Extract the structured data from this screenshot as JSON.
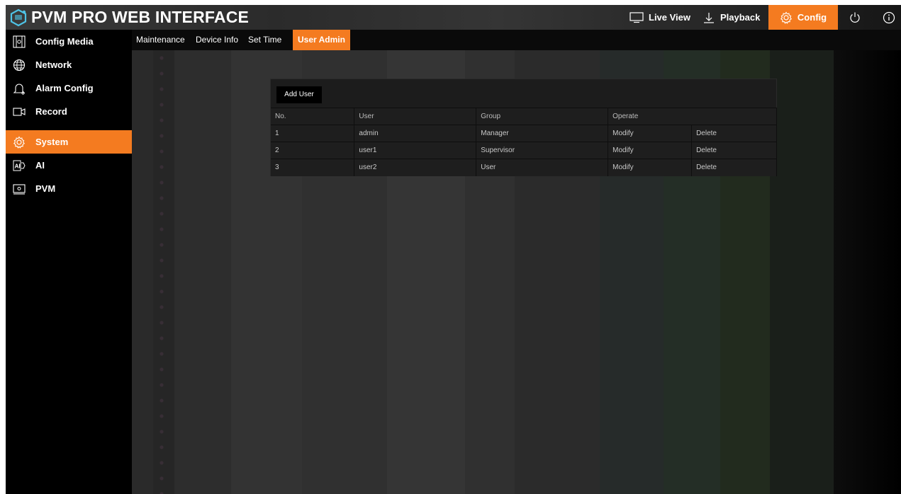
{
  "app": {
    "title": "PVM PRO WEB INTERFACE"
  },
  "topnav": [
    {
      "label": "Live View",
      "icon": "monitor-icon"
    },
    {
      "label": "Playback",
      "icon": "download-arrow-icon"
    },
    {
      "label": "Config",
      "icon": "gear-icon",
      "active": true
    }
  ],
  "topicons": {
    "power": "power-icon",
    "info": "info-icon"
  },
  "sidebar": {
    "items": [
      {
        "label": "Config Media",
        "icon": "media-icon"
      },
      {
        "label": "Network",
        "icon": "globe-icon"
      },
      {
        "label": "Alarm Config",
        "icon": "bell-icon"
      },
      {
        "label": "Record",
        "icon": "camera-icon"
      },
      {
        "label": "System",
        "icon": "gear-icon",
        "active": true
      },
      {
        "label": "AI",
        "icon": "ai-icon"
      },
      {
        "label": "PVM",
        "icon": "pvm-monitor-icon"
      }
    ]
  },
  "subtabs": [
    {
      "label": "Maintenance"
    },
    {
      "label": "Device Info"
    },
    {
      "label": "Set Time"
    },
    {
      "label": "User Admin",
      "active": true
    }
  ],
  "users": {
    "add_button": "Add User",
    "columns": [
      "No.",
      "User",
      "Group",
      "Operate"
    ],
    "rows": [
      {
        "no": "1",
        "user": "admin",
        "group": "Manager",
        "modify": "Modify",
        "delete": "Delete"
      },
      {
        "no": "2",
        "user": "user1",
        "group": "Supervisor",
        "modify": "Modify",
        "delete": "Delete"
      },
      {
        "no": "3",
        "user": "user2",
        "group": "User",
        "modify": "Modify",
        "delete": "Delete"
      }
    ]
  },
  "colors": {
    "accent": "#f47b20",
    "background": "#000000",
    "panel": "#1c1c1c"
  }
}
